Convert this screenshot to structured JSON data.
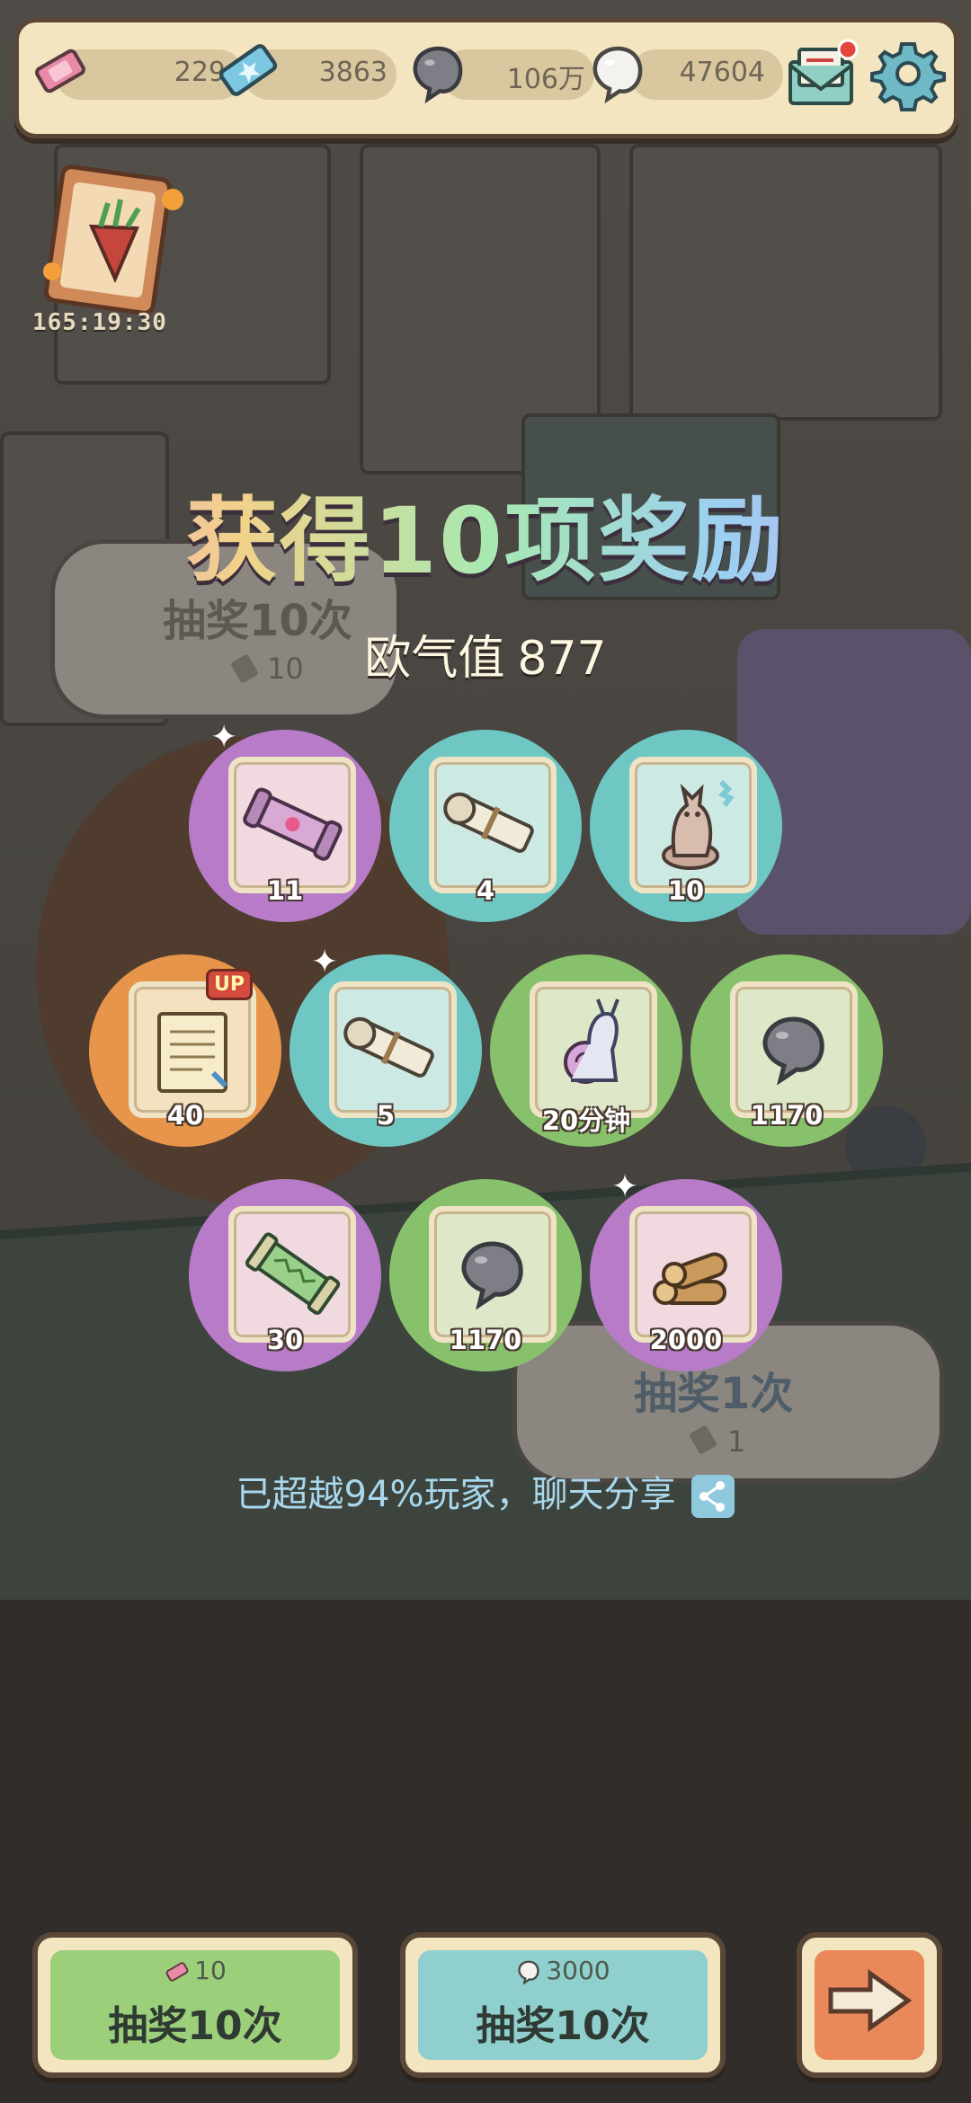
{
  "resources": {
    "ticket_pink": "229",
    "ticket_blue": "3863",
    "soul_gray": "106万",
    "soul_white": "47604"
  },
  "event": {
    "timer": "165:19:30"
  },
  "bubbles": {
    "draw10": {
      "label": "抽奖10次",
      "cost": "10"
    },
    "draw1": {
      "label": "抽奖1次",
      "cost": "1"
    }
  },
  "result": {
    "title": "获得10项奖励",
    "luck_label": "欧气值",
    "luck_value": "877",
    "share_text": "已超越94%玩家，聊天分享"
  },
  "rewards": [
    {
      "qty": "11",
      "color": "purple",
      "icon": "cannon-scroll-icon",
      "sparkle": true
    },
    {
      "qty": "4",
      "color": "teal",
      "icon": "scroll-icon",
      "sparkle": false
    },
    {
      "qty": "10",
      "color": "teal",
      "icon": "cat-statue-icon",
      "sparkle": false
    },
    {
      "qty": "40",
      "color": "orange",
      "icon": "map-scroll-icon",
      "sparkle": false,
      "badge": "UP"
    },
    {
      "qty": "5",
      "color": "teal",
      "icon": "scroll-icon",
      "sparkle": true
    },
    {
      "qty": "20分钟",
      "color": "green",
      "icon": "snail-icon",
      "sparkle": false
    },
    {
      "qty": "1170",
      "color": "green",
      "icon": "soul-icon",
      "sparkle": false
    },
    {
      "qty": "30",
      "color": "purple",
      "icon": "green-scroll-icon",
      "sparkle": false
    },
    {
      "qty": "1170",
      "color": "green",
      "icon": "soul-icon",
      "sparkle": false
    },
    {
      "qty": "2000",
      "color": "purple",
      "icon": "wood-logs-icon",
      "sparkle": true
    }
  ],
  "buttons": {
    "draw_ticket": {
      "cost": "10",
      "label": "抽奖10次"
    },
    "draw_soul": {
      "cost": "3000",
      "label": "抽奖10次"
    },
    "next": {
      "icon": "arrow-right-icon"
    }
  },
  "colors": {
    "purple": "#b77bc8",
    "teal": "#6fc7c4",
    "green": "#88c16b",
    "orange": "#e7954a"
  }
}
